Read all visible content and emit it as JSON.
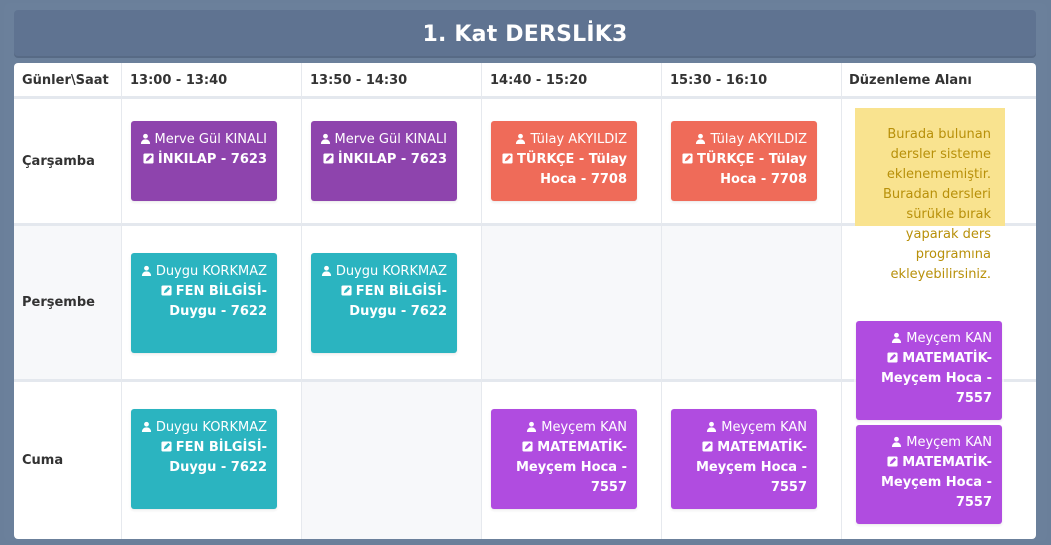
{
  "title": "1. Kat DERSLİK3",
  "headers": [
    "Günler\\Saat",
    "13:00 - 13:40",
    "13:50 - 14:30",
    "14:40 - 15:20",
    "15:30 - 16:10",
    "Düzenleme Alanı"
  ],
  "days": [
    "Çarşamba",
    "Perşembe",
    "Cuma"
  ],
  "note": "Burada bulunan dersler sisteme eklenememiştir. Buradan dersleri sürükle bırak yaparak ders programına ekleyebilirsiniz.",
  "cards": {
    "wed_1": {
      "teacher": "Merve Gül KINALI",
      "course": "İNKILAP - 7623"
    },
    "wed_2": {
      "teacher": "Merve Gül KINALI",
      "course": "İNKILAP - 7623"
    },
    "wed_3": {
      "teacher": "Tülay AKYILDIZ",
      "course": "TÜRKÇE - Tülay Hoca - 7708"
    },
    "wed_4": {
      "teacher": "Tülay AKYILDIZ",
      "course": "TÜRKÇE - Tülay Hoca - 7708"
    },
    "thu_1": {
      "teacher": "Duygu KORKMAZ",
      "course": "FEN BİLGİSİ- Duygu - 7622"
    },
    "thu_2": {
      "teacher": "Duygu KORKMAZ",
      "course": "FEN BİLGİSİ- Duygu - 7622"
    },
    "fri_1": {
      "teacher": "Duygu KORKMAZ",
      "course": "FEN BİLGİSİ- Duygu - 7622"
    },
    "fri_3": {
      "teacher": "Meyçem KAN",
      "course": "MATEMATİK- Meyçem Hoca - 7557"
    },
    "fri_4": {
      "teacher": "Meyçem KAN",
      "course": "MATEMATİK- Meyçem Hoca - 7557"
    },
    "edit_1": {
      "teacher": "Meyçem KAN",
      "course": "MATEMATİK- Meyçem Hoca - 7557"
    },
    "edit_2": {
      "teacher": "Meyçem KAN",
      "course": "MATEMATİK- Meyçem Hoca - 7557"
    }
  },
  "icons": {
    "teacher": "user-icon",
    "course": "edit-icon"
  },
  "colors": {
    "purple": "#8e44ad",
    "salmon": "#ef6b59",
    "teal": "#2bb4c0",
    "violet": "#b04ce0",
    "note": "#f9e38f",
    "header_bar": "#5f7391"
  }
}
